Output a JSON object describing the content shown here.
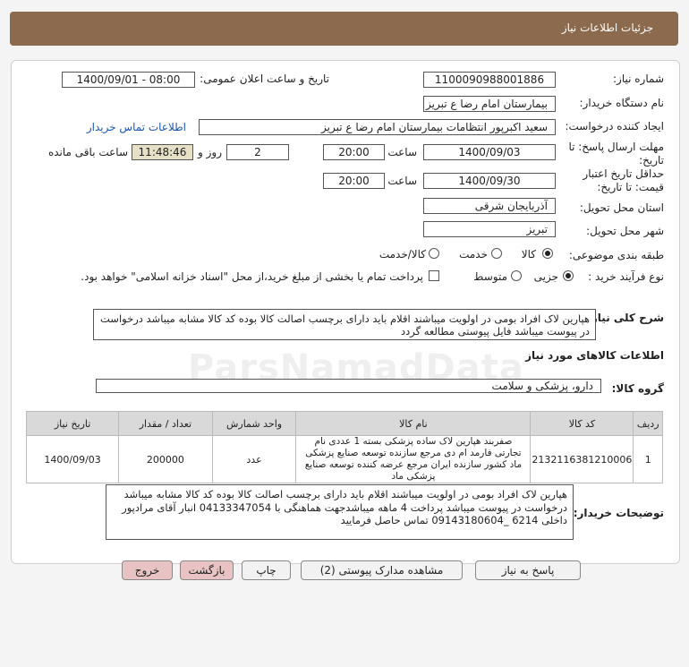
{
  "header": {
    "title": "جزئیات اطلاعات نیاز"
  },
  "form": {
    "need_number_label": "شماره نیاز:",
    "need_number": "1100090988001886",
    "announce_label": "تاریخ و ساعت اعلان عمومی:",
    "announce_value": "1400/09/01 - 08:00",
    "buyer_org_label": "نام دستگاه خریدار:",
    "buyer_org": "بیمارستان امام رضا  ع  تبریز",
    "requester_label": "ایجاد کننده درخواست:",
    "requester": "سعید اکبرپور انتظامات بیمارستان امام رضا  ع  تبریز",
    "contact_link": "اطلاعات تماس خریدار",
    "deadline_label_1": "مهلت ارسال پاسخ: تا",
    "deadline_label_2": "تاریخ:",
    "deadline_date": "1400/09/03",
    "time_label": "ساعت",
    "deadline_time": "20:00",
    "days_value": "2",
    "days_label": "روز و",
    "remaining_time": "11:48:46",
    "remaining_label": "ساعت باقی مانده",
    "validity_label_1": "حداقل تاریخ اعتبار",
    "validity_label_2": "قیمت: تا تاریخ:",
    "validity_date": "1400/09/30",
    "validity_time_label": "ساعت",
    "validity_time": "20:00",
    "province_label": "استان محل تحویل:",
    "province": "آذربایجان شرقی",
    "city_label": "شهر محل تحویل:",
    "city": "تبریز",
    "category_label": "طبقه بندی موضوعی:",
    "category_options": [
      "کالا",
      "خدمت",
      "کالا/خدمت"
    ],
    "process_label": "نوع فرآیند خرید :",
    "process_options": [
      "جزیی",
      "متوسط"
    ],
    "payment_note": "پرداخت تمام یا بخشی از مبلغ خرید،از محل \"اسناد خزانه اسلامی\" خواهد بود."
  },
  "summary": {
    "label": "شرح کلی نیاز:",
    "text": "هپارین لاک افراد بومی در اولویت میباشند اقلام باید دارای برچسب اصالت کالا بوده کد کالا مشابه میباشد درخواست در پیوست میباشد فایل پیوستی مطالعه گردد"
  },
  "goods": {
    "section_title": "اطلاعات کالاهای مورد نیاز",
    "group_label": "گروه کالا:",
    "group_value": "دارو، پزشکی و سلامت",
    "columns": [
      "ردیف",
      "کد کالا",
      "نام کالا",
      "واحد شمارش",
      "تعداد / مقدار",
      "تاریخ نیاز"
    ],
    "rows": [
      {
        "index": "1",
        "code": "2132116381210006",
        "name": "صفربند هپارین لاک ساده پزشکی بسته 1 عددی نام تجارتی فارمد ام دی مرجع سازنده توسعه صنایع پزشکی ماد کشور سازنده ایران مرجع عرضه کننده توسعه صنایع پزشکی ماد",
        "unit": "عدد",
        "quantity": "200000",
        "date": "1400/09/03"
      }
    ]
  },
  "buyer_notes": {
    "label": "توضیحات خریدار:",
    "text": "هپارین لاک افراد بومی در اولویت میباشند اقلام باید دارای برچسب اصالت کالا بوده کد کالا مشابه میباشد درخواست در پیوست میباشد پرداخت 4 ماهه میباشدجهت هماهنگی با 04133347054 انبار آقای مرادپور داخلی 6214 _09143180604 تماس حاصل فرمایید"
  },
  "buttons": {
    "reply": "پاسخ به نیاز",
    "attachments": "مشاهده مدارک پیوستی (2)",
    "print": "چاپ",
    "back": "بازگشت",
    "exit": "خروج"
  },
  "watermark": {
    "text": "ParsNamadData"
  }
}
